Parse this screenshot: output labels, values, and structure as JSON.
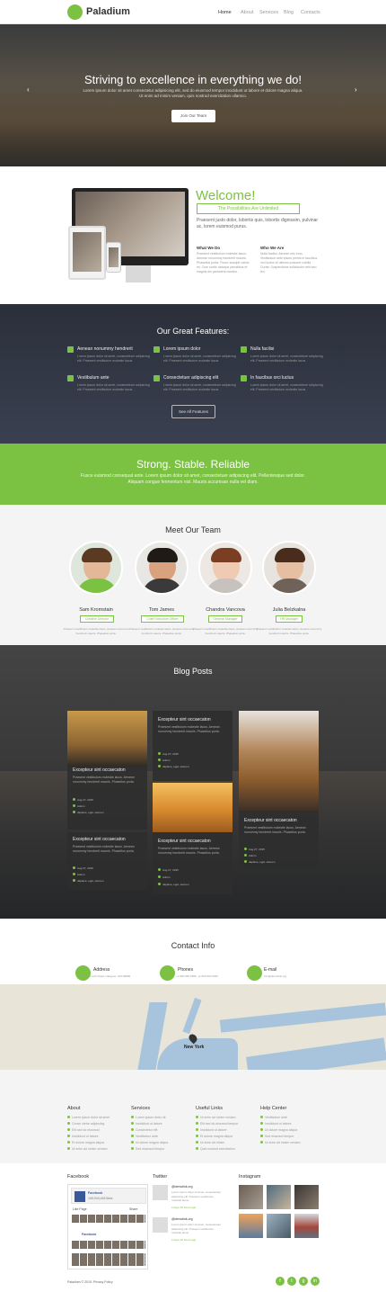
{
  "header": {
    "brand": "Paladium",
    "nav": [
      "Home",
      "About",
      "Services",
      "Blog",
      "Contacts"
    ]
  },
  "hero": {
    "title": "Striving to excellence in everything we do!",
    "subtitle": "Lorem ipsum dolor sit amet consectetur adipisicing elit, sed do eiusmod tempor incididunt ut labore et dolore magna aliqua. Ut enim ad minim veniam, quis nostrud exercitation ullamco.",
    "button": "Join Our Team",
    "prev_icon": "chevron-left-icon",
    "next_icon": "chevron-right-icon"
  },
  "welcome": {
    "title": "Welcome!",
    "badge": "The Possibilities Are Unlimited",
    "text": "Praesent justo dolor, lobortis quis, lobortis dignissim, pulvinar ac, lorem euismod purus.",
    "col1_title": "What We Do",
    "col1_text": "Praesent vestibulum molestie lacus. Aenean nonummy hendrerit mauris. Phasellus porta. Fusce suscipit varius mi. Cum sociis natoque penatibus et magnis dis parturient montes.",
    "col2_title": "Who We Are",
    "col2_text": "Nulla facilisi. Aenean nec eros. Vestibulum ante ipsum primis in faucibus orci luctus et ultrices posuere cubilia Curae; Suspendisse sollicitudin velit sed leo."
  },
  "features": {
    "title": "Our Great Features:",
    "items": [
      {
        "title": "Aenean nonummy hendrerit",
        "text": "Lorem ipsum dolor sit amet, consectetuer adipiscing elit. Praesent vestibulum molestie lacus.",
        "icon": "grid-icon"
      },
      {
        "title": "Lorem ipsum dolor",
        "text": "Lorem ipsum dolor sit amet, consectetuer adipiscing elit. Praesent vestibulum molestie lacus.",
        "icon": "cart-icon"
      },
      {
        "title": "Nulla facilisi",
        "text": "Lorem ipsum dolor sit amet, consectetuer adipiscing elit. Praesent vestibulum molestie lacus.",
        "icon": "laptop-icon"
      },
      {
        "title": "Vestibulum ante",
        "text": "Lorem ipsum dolor sit amet, consectetuer adipiscing elit. Praesent vestibulum molestie lacus.",
        "icon": "phone-icon"
      },
      {
        "title": "Consectetuer adipiscing elit",
        "text": "Lorem ipsum dolor sit amet, consectetuer adipiscing elit. Praesent vestibulum molestie lacus.",
        "icon": "gears-icon"
      },
      {
        "title": "In faucibus orci luctus",
        "text": "Lorem ipsum dolor sit amet, consectetuer adipiscing elit. Praesent vestibulum molestie lacus.",
        "icon": "pin-icon"
      }
    ],
    "button": "See All Features"
  },
  "strong": {
    "title": "Strong. Stable. Reliable",
    "text": "Fusce euismod consequat ante. Lorem ipsum dolor sit amet, consectetuer adipiscing elit. Pellentesque sed dolor. Aliquam congue fermentum nisl. Mauris accumsan nulla vel diam."
  },
  "team": {
    "title": "Meet Our Team",
    "members": [
      {
        "name": "Sam Kromstain",
        "role": "Creative Director",
        "text": "Praesent vestibulum molestie lacus. Aenean nonummy hendrerit mauris. Phasellus porta."
      },
      {
        "name": "Tom James",
        "role": "Chief Executive Officer",
        "text": "Praesent vestibulum molestie lacus. Aenean nonummy hendrerit mauris. Phasellus porta."
      },
      {
        "name": "Chandra Vancova",
        "role": "General Manager",
        "text": "Praesent vestibulum molestie lacus. Aenean nonummy hendrerit mauris. Phasellus porta."
      },
      {
        "name": "Julia Belzkalna",
        "role": "HR Manager",
        "text": "Praesent vestibulum molestie lacus. Aenean nonummy hendrerit mauris. Phasellus porta."
      }
    ]
  },
  "blog": {
    "title": "Blog Posts",
    "posts": [
      {
        "title": "Excepteur sint occaecaton",
        "text": "Praesent vestibulum molestie lacus. Aenean nonummy hendrerit mauris. Phasellus porta.",
        "date": "Aug 27, 2015",
        "author": "Admin",
        "tags": "daplace, eget, elemen"
      },
      {
        "title": "Excepteur sint occaecaton",
        "text": "Praesent vestibulum molestie lacus. Aenean nonummy hendrerit mauris. Phasellus porta.",
        "date": "Aug 27, 2015",
        "author": "Admin",
        "tags": "daplace, eget, elemen"
      },
      {
        "title": "Excepteur sint occaecaton",
        "text": "Praesent vestibulum molestie lacus. Aenean nonummy hendrerit mauris. Phasellus porta.",
        "date": "Aug 27, 2015",
        "author": "Admin",
        "tags": "daplace, eget, elemen"
      },
      {
        "title": "Excepteur sint occaecaton",
        "text": "Praesent vestibulum molestie lacus. Aenean nonummy hendrerit mauris. Phasellus porta.",
        "date": "Aug 27, 2015",
        "author": "Admin",
        "tags": "daplace, eget, elemen"
      },
      {
        "title": "Excepteur sint occaecaton",
        "text": "Praesent vestibulum molestie lacus. Aenean nonummy hendrerit mauris. Phasellus porta.",
        "date": "Aug 27, 2015",
        "author": "Admin",
        "tags": "daplace, eget, elemen"
      }
    ]
  },
  "contact": {
    "title": "Contact Info",
    "address_label": "Address",
    "address": "4917 Mammoth Road, Glasgow, G50 9BNB",
    "phones_label": "Phones",
    "phones": "+1 800 559 6580, +1 800 603 6035",
    "email_label": "E-mail",
    "email": "info@demolink.org"
  },
  "map": {
    "label": "New York"
  },
  "footer_links": {
    "columns": [
      {
        "title": "About",
        "items": [
          "Lorem ipsum dolor sit amet",
          "Conse ctetur adipiscing",
          "Elit sed do eiusmod",
          "Incididunt ut labore",
          "Et dolore magna aliqua",
          "Ut enim ad minim veniam"
        ]
      },
      {
        "title": "Services",
        "items": [
          "Lorem ipsum dolor sit",
          "Incididunt ut labore",
          "Consectetur elit",
          "Vestibulum ante",
          "Ut dolore magna aliqua",
          "Sed eiusmod tempor"
        ]
      },
      {
        "title": "Useful Links",
        "items": [
          "Ut enim ad minim veniam",
          "Elit sed do eiusmod tempor",
          "Incididunt ut labore",
          "Et dolore magna aliqua",
          "Ut enim ad minim",
          "Quis nostrud exercitation"
        ]
      },
      {
        "title": "Help Center",
        "items": [
          "Vestibulum ante",
          "Incididunt ut labore",
          "Ut dolore magna aliqua",
          "Sed eiusmod tempor",
          "Ut enim ad minim veniam"
        ]
      }
    ]
  },
  "social": {
    "facebook_title": "Facebook",
    "fb_page": "Facebook",
    "fb_likes": "105,944,443 likes",
    "fb_like_btn": "Like Page",
    "fb_share_btn": "Share",
    "twitter_title": "Twitter",
    "tweets": [
      {
        "name": "@demolink.org",
        "text": "Lorem ipsum dolor sit amet, consectetuer adipiscing elit. Praesent vestibulum molestie lacus.",
        "time": "2 days 16 hours ago"
      },
      {
        "name": "@demolink.org",
        "text": "Lorem ipsum dolor sit amet, consectetuer adipiscing elit. Praesent vestibulum molestie lacus.",
        "time": "2 days 16 hours ago"
      }
    ],
    "instagram_title": "Instagram",
    "copyright": "Paladium © 2015. Privacy Policy",
    "icons": [
      "f",
      "t",
      "g",
      "in"
    ]
  },
  "colors": {
    "accent": "#7cc242",
    "dark": "#2a2f3a"
  }
}
